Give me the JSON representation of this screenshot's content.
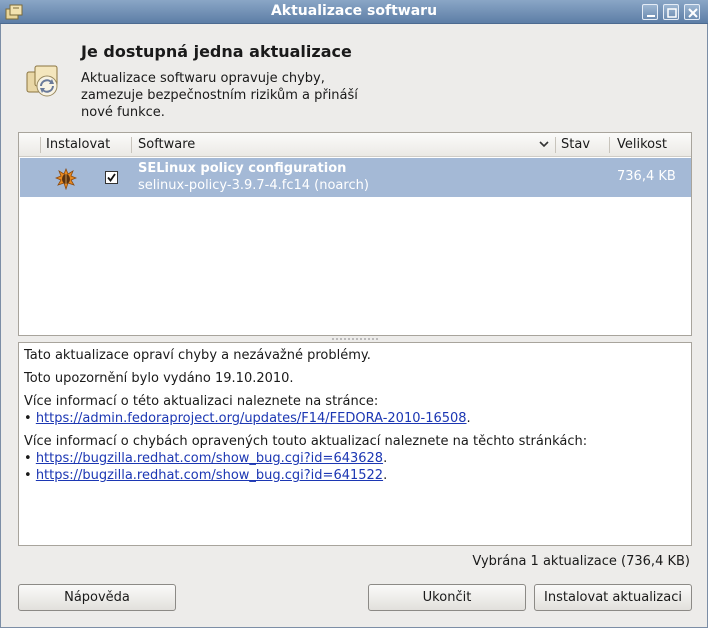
{
  "window": {
    "title": "Aktualizace softwaru",
    "controls": [
      "minimize-icon",
      "maximize-icon",
      "close-icon"
    ]
  },
  "header": {
    "title": "Je dostupná jedna aktualizace",
    "description_lines": [
      "Aktualizace softwaru opravuje chyby,",
      "zamezuje bezpečnostním rizikům a přináší",
      "nové funkce."
    ]
  },
  "list": {
    "columns": {
      "install": "Instalovat",
      "software": "Software",
      "status": "Stav",
      "size": "Velikost"
    },
    "rows": [
      {
        "checked": true,
        "name": "SELinux policy configuration",
        "version": "selinux-policy-3.9.7-4.fc14 (noarch)",
        "status": "",
        "size": "736,4 KB",
        "icon": "package-bug-icon"
      }
    ]
  },
  "details": {
    "line1": "Tato aktualizace opraví chyby a nezávažné problémy.",
    "line2": "Toto upozornění bylo vydáno 19.10.2010.",
    "more_info_update": "Více informací o této aktualizaci naleznete na stránce:",
    "update_link": "https://admin.fedoraproject.org/updates/F14/FEDORA-2010-16508",
    "more_info_bugs": "Více informací o chybách opravených touto aktualizací naleznete na těchto stránkách:",
    "bug_links": [
      "https://bugzilla.redhat.com/show_bug.cgi?id=643628",
      "https://bugzilla.redhat.com/show_bug.cgi?id=641522"
    ],
    "bullet": "•",
    "period": "."
  },
  "status_text": "Vybrána 1 aktualizace (736,4 KB)",
  "buttons": {
    "help": "Nápověda",
    "quit": "Ukončit",
    "install": "Instalovat aktualizaci"
  },
  "colors": {
    "selection": "#a4b9d6",
    "titlebar": "#5d7ea6",
    "link": "#1c37b3"
  }
}
